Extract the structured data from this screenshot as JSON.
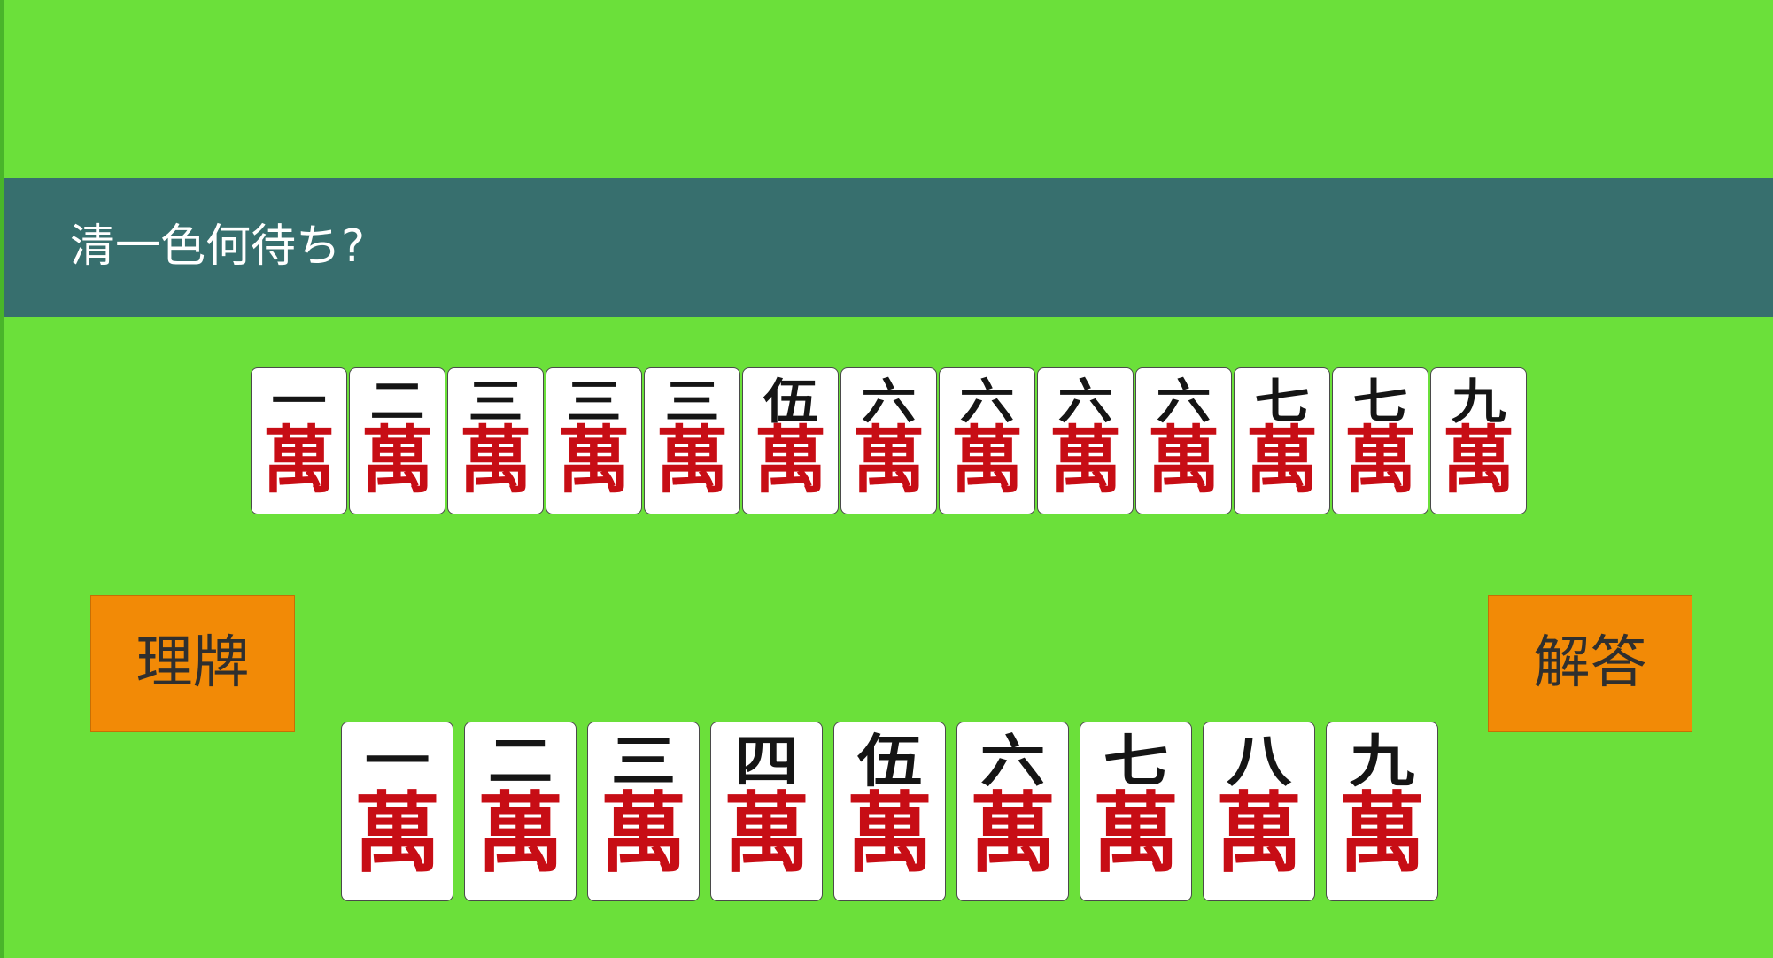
{
  "question": {
    "text": "清一色何待ち?"
  },
  "hand": {
    "suit": "萬",
    "tiles": [
      {
        "rank": 1,
        "numeral": "一"
      },
      {
        "rank": 2,
        "numeral": "二"
      },
      {
        "rank": 3,
        "numeral": "三"
      },
      {
        "rank": 3,
        "numeral": "三"
      },
      {
        "rank": 3,
        "numeral": "三"
      },
      {
        "rank": 5,
        "numeral": "伍"
      },
      {
        "rank": 6,
        "numeral": "六"
      },
      {
        "rank": 6,
        "numeral": "六"
      },
      {
        "rank": 6,
        "numeral": "六"
      },
      {
        "rank": 6,
        "numeral": "六"
      },
      {
        "rank": 7,
        "numeral": "七"
      },
      {
        "rank": 7,
        "numeral": "七"
      },
      {
        "rank": 9,
        "numeral": "九"
      }
    ]
  },
  "choices": {
    "suit": "萬",
    "tiles": [
      {
        "rank": 1,
        "numeral": "一"
      },
      {
        "rank": 2,
        "numeral": "二"
      },
      {
        "rank": 3,
        "numeral": "三"
      },
      {
        "rank": 4,
        "numeral": "四"
      },
      {
        "rank": 5,
        "numeral": "伍"
      },
      {
        "rank": 6,
        "numeral": "六"
      },
      {
        "rank": 7,
        "numeral": "七"
      },
      {
        "rank": 8,
        "numeral": "八"
      },
      {
        "rank": 9,
        "numeral": "九"
      }
    ]
  },
  "buttons": {
    "sort_label": "理牌",
    "answer_label": "解答"
  },
  "colors": {
    "table_green": "#6be03a",
    "question_bar": "#376f6e",
    "button_orange": "#f28a06",
    "tile_numeral": "#151515",
    "tile_suit_red": "#c70d15"
  }
}
